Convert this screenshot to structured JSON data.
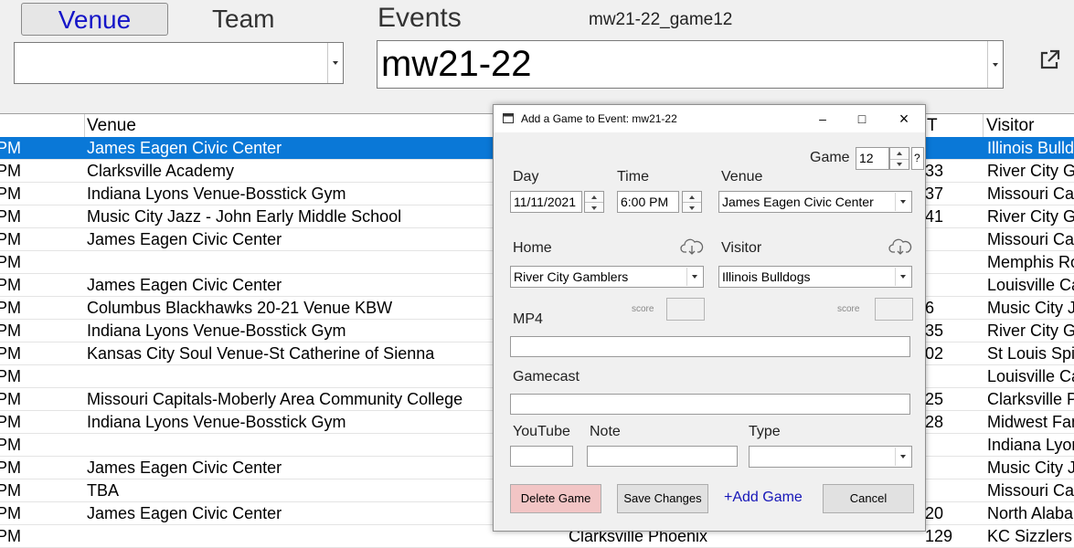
{
  "top": {
    "venue_btn": "Venue",
    "team_label": "Team",
    "events_label": "Events",
    "event_code": "mw21-22_game12",
    "venue_combo_value": "",
    "event_combo_value": "mw21-22"
  },
  "grid": {
    "headers": {
      "venue": "Venue",
      "st": "T",
      "visitor": "Visitor"
    },
    "rows": [
      {
        "time": "PM",
        "venue": "James Eagen Civic Center",
        "home": "",
        "st": "",
        "visitor": "Illinois Bulldogs"
      },
      {
        "time": "PM",
        "venue": "Clarksville Academy",
        "home": "",
        "st": "33",
        "visitor": "River City Gamblers"
      },
      {
        "time": "PM",
        "venue": "Indiana Lyons Venue-Bosstick Gym",
        "home": "",
        "st": "37",
        "visitor": "Missouri Capitals"
      },
      {
        "time": "PM",
        "venue": "Music City Jazz - John Early Middle School",
        "home": "",
        "st": "41",
        "visitor": "River City Gamblers"
      },
      {
        "time": "PM",
        "venue": "James Eagen Civic Center",
        "home": "",
        "st": "",
        "visitor": "Missouri Capitals"
      },
      {
        "time": "PM",
        "venue": "",
        "home": "",
        "st": "",
        "visitor": "Memphis Royals"
      },
      {
        "time": "PM",
        "venue": "James Eagen Civic Center",
        "home": "",
        "st": "",
        "visitor": "Louisville Cardinals"
      },
      {
        "time": "PM",
        "venue": "Columbus Blackhawks 20-21 Venue KBW",
        "home": "",
        "st": "6",
        "visitor": "Music City Jazz"
      },
      {
        "time": "PM",
        "venue": "Indiana Lyons Venue-Bosstick Gym",
        "home": "",
        "st": "35",
        "visitor": "River City Gamblers"
      },
      {
        "time": "PM",
        "venue": "Kansas City Soul Venue-St Catherine of Sienna",
        "home": "",
        "st": "02",
        "visitor": "St Louis Spirits"
      },
      {
        "time": "PM",
        "venue": "",
        "home": "",
        "st": "",
        "visitor": "Louisville Cardinals"
      },
      {
        "time": "PM",
        "venue": "Missouri Capitals-Moberly Area Community College",
        "home": "",
        "st": "25",
        "visitor": "Clarksville Phoenix"
      },
      {
        "time": "PM",
        "venue": "Indiana Lyons Venue-Bosstick Gym",
        "home": "",
        "st": "28",
        "visitor": "Midwest Fames"
      },
      {
        "time": "PM",
        "venue": "",
        "home": "",
        "st": "",
        "visitor": "Indiana Lyons"
      },
      {
        "time": "PM",
        "venue": "James Eagen Civic Center",
        "home": "",
        "st": "",
        "visitor": "Music City Jazz"
      },
      {
        "time": "PM",
        "venue": "TBA",
        "home": "",
        "st": "",
        "visitor": "Missouri Capitals"
      },
      {
        "time": "PM",
        "venue": "James Eagen Civic Center",
        "home": "",
        "st": "20",
        "visitor": "North Alabama"
      },
      {
        "time": "PM",
        "venue": "",
        "home": "Clarksville Phoenix",
        "st": "129",
        "visitor": "KC Sizzlers"
      }
    ]
  },
  "dialog": {
    "title": "Add a Game to Event: mw21-22",
    "game_label": "Game",
    "game_value": "12",
    "day_label": "Day",
    "day_value": "11/11/2021",
    "time_label": "Time",
    "time_value": "6:00 PM",
    "venue_label": "Venue",
    "venue_value": "James Eagen Civic Center",
    "home_label": "Home",
    "home_value": "River City Gamblers",
    "visitor_label": "Visitor",
    "visitor_value": "Illinois Bulldogs",
    "score_label": "score",
    "home_score": "",
    "visitor_score": "",
    "mp4_label": "MP4",
    "mp4_value": "",
    "gamecast_label": "Gamecast",
    "gamecast_value": "",
    "youtube_label": "YouTube",
    "youtube_value": "",
    "note_label": "Note",
    "note_value": "",
    "type_label": "Type",
    "type_value": "",
    "delete_label": "Delete Game",
    "save_label": "Save Changes",
    "add_label": "+Add Game",
    "cancel_label": "Cancel",
    "help_label": "?"
  },
  "colors": {
    "selection": "#0a78d7",
    "link": "#1616b8",
    "delete_btn": "#f2c5c5"
  }
}
